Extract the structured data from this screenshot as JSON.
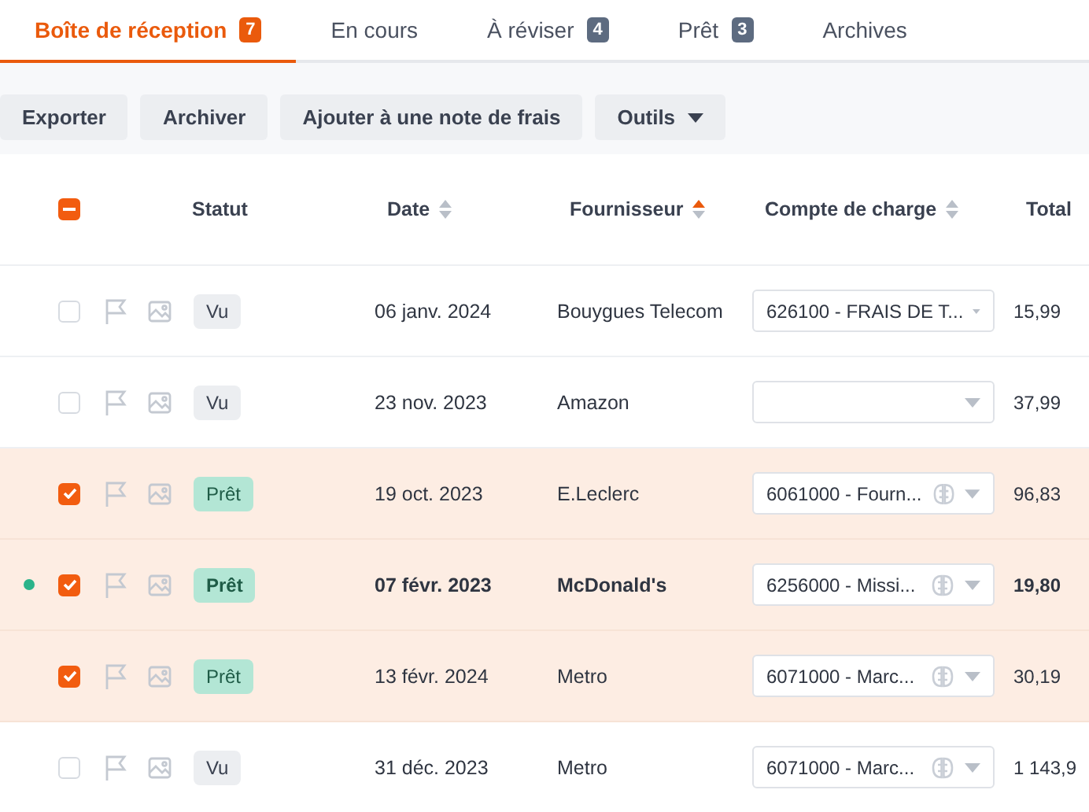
{
  "tabs": [
    {
      "label": "Boîte de réception",
      "count": "7",
      "selected": true
    },
    {
      "label": "En cours",
      "selected": false
    },
    {
      "label": "À réviser",
      "count": "4",
      "selected": false
    },
    {
      "label": "Prêt",
      "count": "3",
      "selected": false
    },
    {
      "label": "Archives",
      "selected": false
    }
  ],
  "toolbar": [
    {
      "label": "Exporter",
      "dropdown": false
    },
    {
      "label": "Archiver",
      "dropdown": false
    },
    {
      "label": "Ajouter à une note de frais",
      "dropdown": false
    },
    {
      "label": "Outils",
      "dropdown": true
    }
  ],
  "table": {
    "select_all_partial": true,
    "columns": [
      {
        "label": "Statut",
        "sortable": false
      },
      {
        "label": "Date",
        "sortable": true,
        "sort_active": false
      },
      {
        "label": "Fournisseur",
        "sortable": true,
        "sort_active": true
      },
      {
        "label": "Compte de charge",
        "sortable": true,
        "sort_active": false
      },
      {
        "label": "Total",
        "sortable": false
      }
    ],
    "rows": [
      {
        "selected": false,
        "unread": false,
        "status": {
          "label": "Vu",
          "kind": "seen"
        },
        "date": "06 janv. 2024",
        "supplier": "Bouygues Telecom",
        "account": {
          "value": "626100 - FRAIS DE T...",
          "suggested": false
        },
        "total": "15,99"
      },
      {
        "selected": false,
        "unread": false,
        "status": {
          "label": "Vu",
          "kind": "seen"
        },
        "date": "23 nov. 2023",
        "supplier": "Amazon",
        "account": {
          "suggested": false
        },
        "total": "37,99"
      },
      {
        "selected": true,
        "unread": false,
        "status": {
          "label": "Prêt",
          "kind": "ready"
        },
        "date": "19 oct. 2023",
        "supplier": "E.Leclerc",
        "account": {
          "value": "6061000 - Fourn...",
          "suggested": true
        },
        "total": "96,83"
      },
      {
        "selected": true,
        "unread": true,
        "status": {
          "label": "Prêt",
          "kind": "ready"
        },
        "date": "07 févr. 2023",
        "supplier": "McDonald's",
        "account": {
          "value": "6256000 - Missi...",
          "suggested": true
        },
        "total": "19,80"
      },
      {
        "selected": true,
        "unread": false,
        "status": {
          "label": "Prêt",
          "kind": "ready"
        },
        "date": "13 févr. 2024",
        "supplier": "Metro",
        "account": {
          "value": "6071000 - Marc...",
          "suggested": true
        },
        "total": "30,19"
      },
      {
        "selected": false,
        "unread": false,
        "status": {
          "label": "Vu",
          "kind": "seen"
        },
        "date": "31 déc. 2023",
        "supplier": "Metro",
        "account": {
          "value": "6071000 - Marc...",
          "suggested": true
        },
        "total": "1 143,9"
      }
    ]
  }
}
